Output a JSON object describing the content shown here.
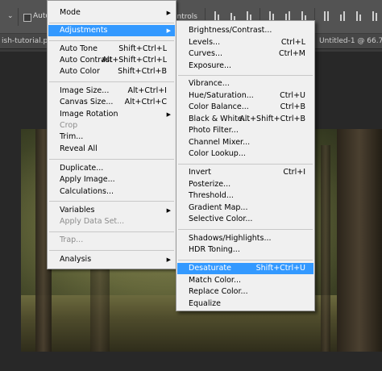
{
  "optbar": {
    "auto_label": "Auto-",
    "controls_label": "ontrols",
    "dropdown_arrow": "⌄"
  },
  "tabs": {
    "left": "ish-tutorial.psd",
    "right": "Untitled-1 @ 66.7%"
  },
  "image_menu": {
    "items": [
      {
        "label": "Mode",
        "shortcut": "",
        "submenu": true,
        "disabled": false,
        "highlighted": false
      },
      {
        "label": "Adjustments",
        "shortcut": "",
        "submenu": true,
        "disabled": false,
        "highlighted": true
      },
      {
        "label": "Auto Tone",
        "shortcut": "Shift+Ctrl+L",
        "submenu": false,
        "disabled": false,
        "highlighted": false
      },
      {
        "label": "Auto Contrast",
        "shortcut": "Alt+Shift+Ctrl+L",
        "submenu": false,
        "disabled": false,
        "highlighted": false
      },
      {
        "label": "Auto Color",
        "shortcut": "Shift+Ctrl+B",
        "submenu": false,
        "disabled": false,
        "highlighted": false
      },
      {
        "label": "Image Size...",
        "shortcut": "Alt+Ctrl+I",
        "submenu": false,
        "disabled": false,
        "highlighted": false
      },
      {
        "label": "Canvas Size...",
        "shortcut": "Alt+Ctrl+C",
        "submenu": false,
        "disabled": false,
        "highlighted": false
      },
      {
        "label": "Image Rotation",
        "shortcut": "",
        "submenu": true,
        "disabled": false,
        "highlighted": false
      },
      {
        "label": "Crop",
        "shortcut": "",
        "submenu": false,
        "disabled": true,
        "highlighted": false
      },
      {
        "label": "Trim...",
        "shortcut": "",
        "submenu": false,
        "disabled": false,
        "highlighted": false
      },
      {
        "label": "Reveal All",
        "shortcut": "",
        "submenu": false,
        "disabled": false,
        "highlighted": false
      },
      {
        "label": "Duplicate...",
        "shortcut": "",
        "submenu": false,
        "disabled": false,
        "highlighted": false
      },
      {
        "label": "Apply Image...",
        "shortcut": "",
        "submenu": false,
        "disabled": false,
        "highlighted": false
      },
      {
        "label": "Calculations...",
        "shortcut": "",
        "submenu": false,
        "disabled": false,
        "highlighted": false
      },
      {
        "label": "Variables",
        "shortcut": "",
        "submenu": true,
        "disabled": false,
        "highlighted": false
      },
      {
        "label": "Apply Data Set...",
        "shortcut": "",
        "submenu": false,
        "disabled": true,
        "highlighted": false
      },
      {
        "label": "Trap...",
        "shortcut": "",
        "submenu": false,
        "disabled": true,
        "highlighted": false
      },
      {
        "label": "Analysis",
        "shortcut": "",
        "submenu": true,
        "disabled": false,
        "highlighted": false
      }
    ]
  },
  "adjustments_menu": {
    "items": [
      {
        "label": "Brightness/Contrast...",
        "shortcut": "",
        "highlighted": false
      },
      {
        "label": "Levels...",
        "shortcut": "Ctrl+L",
        "highlighted": false
      },
      {
        "label": "Curves...",
        "shortcut": "Ctrl+M",
        "highlighted": false
      },
      {
        "label": "Exposure...",
        "shortcut": "",
        "highlighted": false
      },
      {
        "label": "Vibrance...",
        "shortcut": "",
        "highlighted": false
      },
      {
        "label": "Hue/Saturation...",
        "shortcut": "Ctrl+U",
        "highlighted": false
      },
      {
        "label": "Color Balance...",
        "shortcut": "Ctrl+B",
        "highlighted": false
      },
      {
        "label": "Black & White...",
        "shortcut": "Alt+Shift+Ctrl+B",
        "highlighted": false
      },
      {
        "label": "Photo Filter...",
        "shortcut": "",
        "highlighted": false
      },
      {
        "label": "Channel Mixer...",
        "shortcut": "",
        "highlighted": false
      },
      {
        "label": "Color Lookup...",
        "shortcut": "",
        "highlighted": false
      },
      {
        "label": "Invert",
        "shortcut": "Ctrl+I",
        "highlighted": false
      },
      {
        "label": "Posterize...",
        "shortcut": "",
        "highlighted": false
      },
      {
        "label": "Threshold...",
        "shortcut": "",
        "highlighted": false
      },
      {
        "label": "Gradient Map...",
        "shortcut": "",
        "highlighted": false
      },
      {
        "label": "Selective Color...",
        "shortcut": "",
        "highlighted": false
      },
      {
        "label": "Shadows/Highlights...",
        "shortcut": "",
        "highlighted": false
      },
      {
        "label": "HDR Toning...",
        "shortcut": "",
        "highlighted": false
      },
      {
        "label": "Desaturate",
        "shortcut": "Shift+Ctrl+U",
        "highlighted": true
      },
      {
        "label": "Match Color...",
        "shortcut": "",
        "highlighted": false
      },
      {
        "label": "Replace Color...",
        "shortcut": "",
        "highlighted": false
      },
      {
        "label": "Equalize",
        "shortcut": "",
        "highlighted": false
      }
    ]
  },
  "colors": {
    "highlight": "#3399ff",
    "menu_bg": "#f0f0f0",
    "disabled_text": "#8c8c8c"
  }
}
